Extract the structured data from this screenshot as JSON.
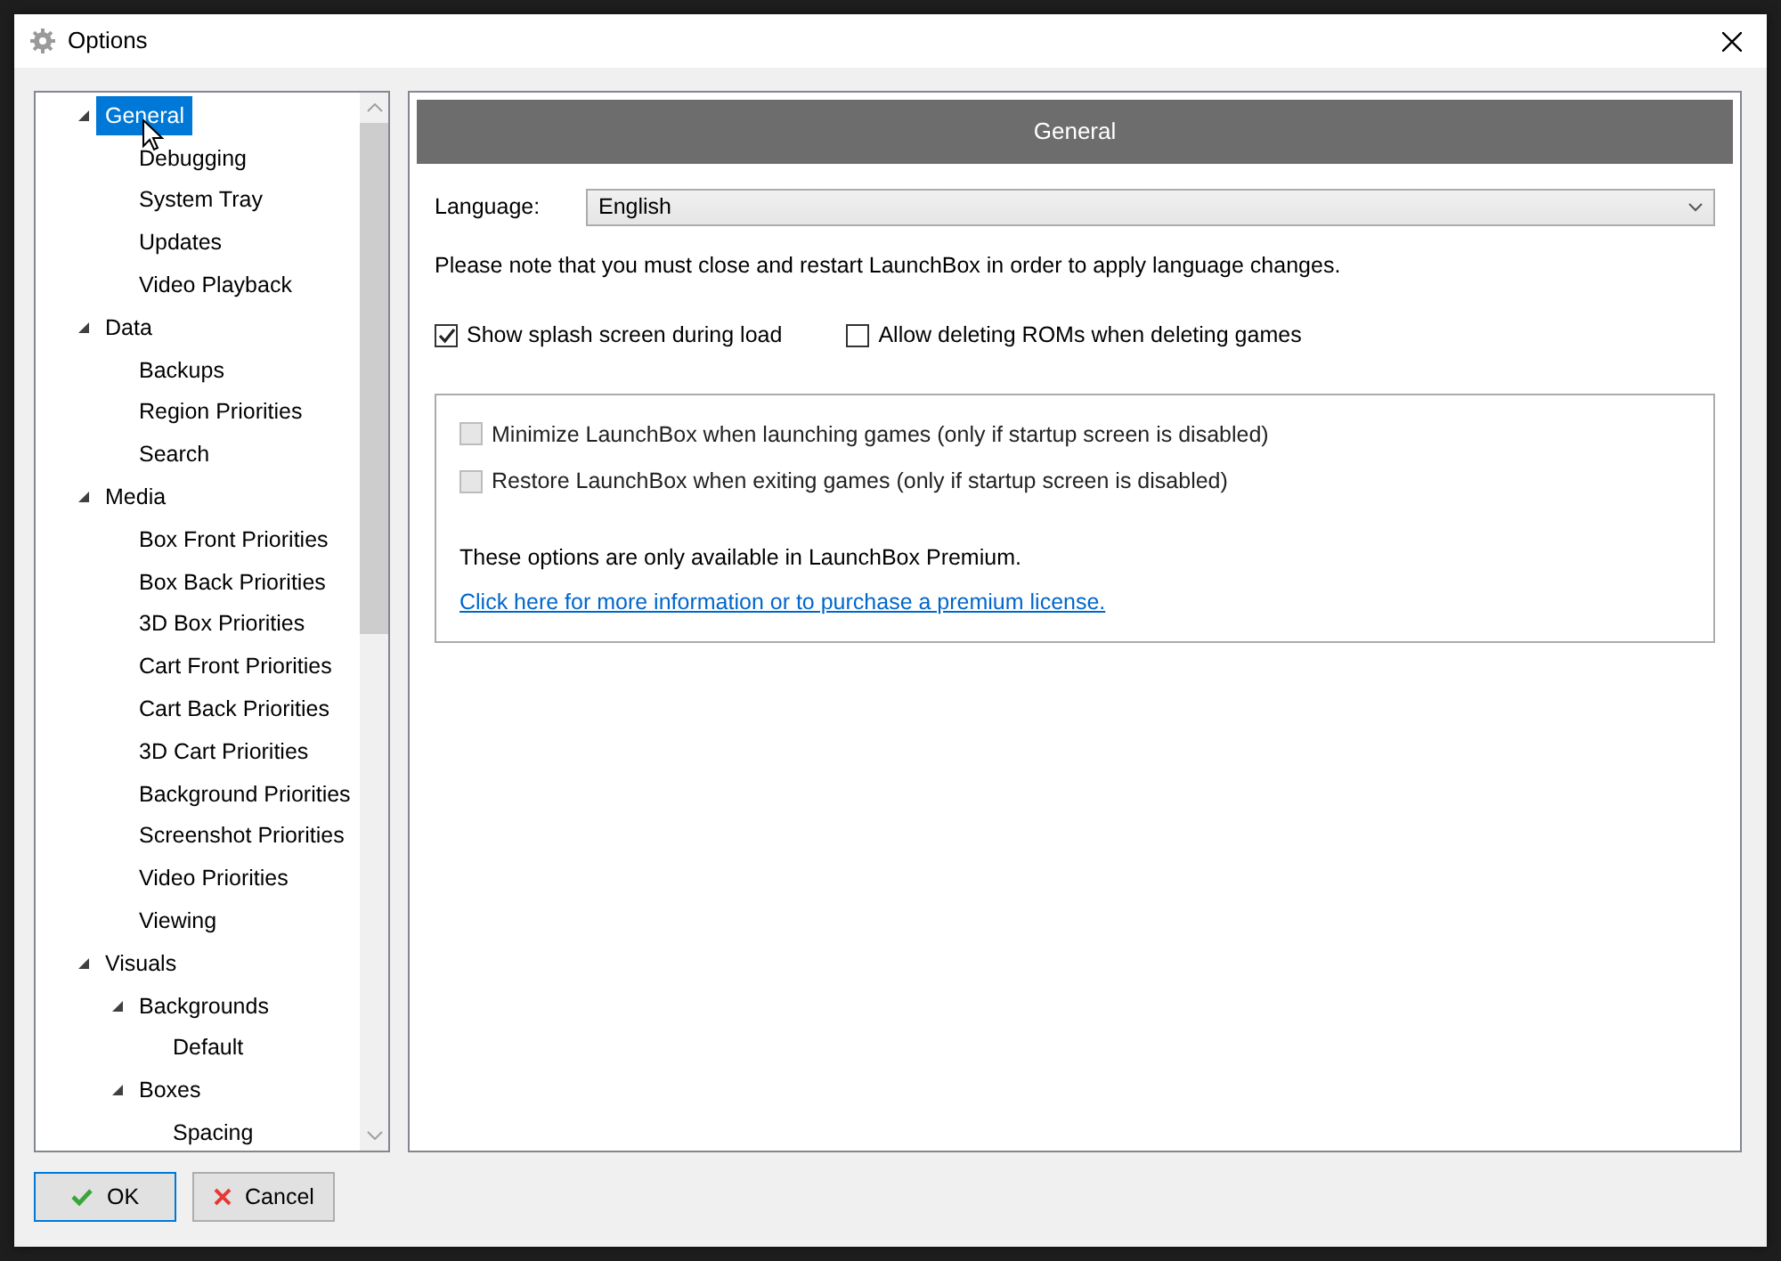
{
  "window": {
    "title": "Options"
  },
  "tree": [
    {
      "label": "General",
      "selected": true,
      "expanded": true,
      "children": [
        {
          "label": "Debugging",
          "selected": false
        },
        {
          "label": "System Tray",
          "selected": false
        },
        {
          "label": "Updates",
          "selected": false
        },
        {
          "label": "Video Playback",
          "selected": false
        }
      ]
    },
    {
      "label": "Data",
      "selected": false,
      "expanded": true,
      "children": [
        {
          "label": "Backups",
          "selected": false
        },
        {
          "label": "Region Priorities",
          "selected": false
        },
        {
          "label": "Search",
          "selected": false
        }
      ]
    },
    {
      "label": "Media",
      "selected": false,
      "expanded": true,
      "children": [
        {
          "label": "Box Front Priorities",
          "selected": false
        },
        {
          "label": "Box Back Priorities",
          "selected": false
        },
        {
          "label": "3D Box Priorities",
          "selected": false
        },
        {
          "label": "Cart Front Priorities",
          "selected": false
        },
        {
          "label": "Cart Back Priorities",
          "selected": false
        },
        {
          "label": "3D Cart Priorities",
          "selected": false
        },
        {
          "label": "Background Priorities",
          "selected": false
        },
        {
          "label": "Screenshot Priorities",
          "selected": false
        },
        {
          "label": "Video Priorities",
          "selected": false
        },
        {
          "label": "Viewing",
          "selected": false
        }
      ]
    },
    {
      "label": "Visuals",
      "selected": false,
      "expanded": true,
      "children": [
        {
          "label": "Backgrounds",
          "selected": false,
          "expanded": true,
          "children": [
            {
              "label": "Default",
              "selected": false
            }
          ]
        },
        {
          "label": "Boxes",
          "selected": false,
          "expanded": true,
          "children": [
            {
              "label": "Spacing",
              "selected": false
            }
          ]
        }
      ]
    }
  ],
  "panel": {
    "header": "General",
    "language_label": "Language:",
    "language_value": "English",
    "note": "Please note that you must close and restart LaunchBox in order to apply language changes.",
    "options": [
      {
        "label": "Show splash screen during load",
        "checked": true,
        "disabled": false
      },
      {
        "label": "Allow deleting ROMs when deleting games",
        "checked": false,
        "disabled": false
      }
    ],
    "premium_options": [
      {
        "label": "Minimize LaunchBox when launching games (only if startup screen is disabled)",
        "checked": false,
        "disabled": true
      },
      {
        "label": "Restore LaunchBox when exiting games (only if startup screen is disabled)",
        "checked": false,
        "disabled": true
      }
    ],
    "premium_note": "These options are only available in LaunchBox Premium.",
    "premium_link": "Click here for more information or to purchase a premium license."
  },
  "buttons": [
    {
      "label": "OK",
      "kind": "ok"
    },
    {
      "label": "Cancel",
      "kind": "cancel"
    }
  ]
}
